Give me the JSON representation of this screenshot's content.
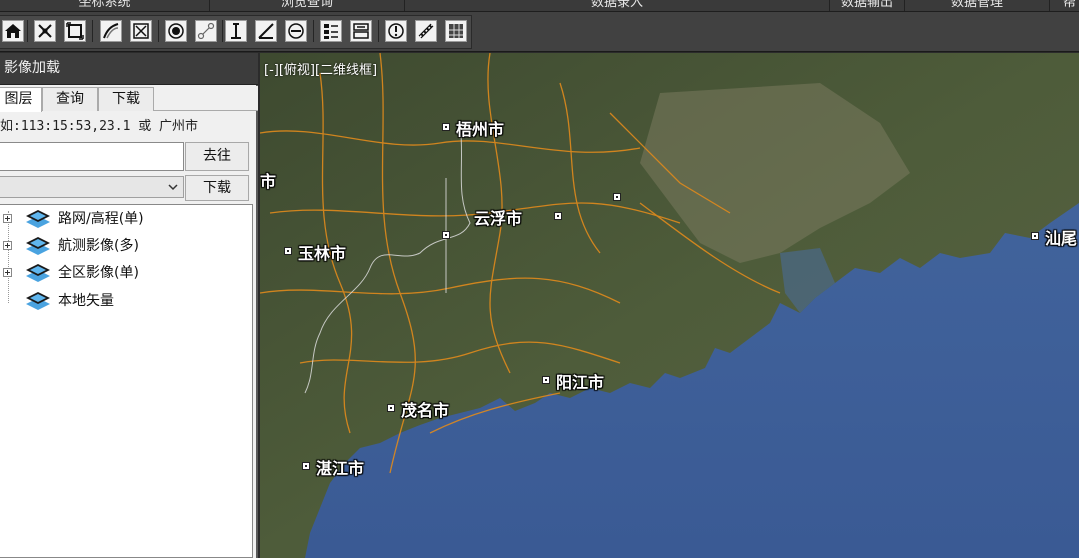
{
  "menu": {
    "items": [
      "坐标系统",
      "浏览查询",
      "数据录入",
      "数据输出",
      "数据管理",
      "帮"
    ]
  },
  "toolbar": {
    "buttons": [
      "home-icon",
      "pan-icon",
      "fullscreen-icon",
      "pen-icon",
      "clear-icon",
      "record-icon",
      "route-icon",
      "vertical-measure-icon",
      "angle-measure-icon",
      "minus-circle-icon",
      "layer-list-icon",
      "switch-icon",
      "info-icon",
      "ruler-icon",
      "grid-icon"
    ]
  },
  "panel": {
    "title": "影像加载",
    "tabs": [
      "图层",
      "查询",
      "下载"
    ],
    "active_tab": "图层",
    "location_hint": "如:113:15:53,23.1 或 广州市",
    "location_value": "",
    "goto_label": "去往",
    "select_value": "",
    "download_label": "下载",
    "layers": [
      {
        "label": "路网/高程(单)",
        "expandable": true
      },
      {
        "label": "航测影像(多)",
        "expandable": true
      },
      {
        "label": "全区影像(单)",
        "expandable": true
      },
      {
        "label": "本地矢量",
        "expandable": false
      }
    ]
  },
  "map": {
    "view_label": "[-][俯视][二维线框]",
    "cities": [
      "梧州市",
      "云浮市",
      "玉林市",
      "阳江市",
      "茂名市",
      "湛江市",
      "汕尾",
      "市"
    ],
    "colors": {
      "land": "#4b5a38",
      "sea": "#3b5f9c",
      "road": "#e08a1c",
      "boundary": "#d8d8d8"
    }
  }
}
